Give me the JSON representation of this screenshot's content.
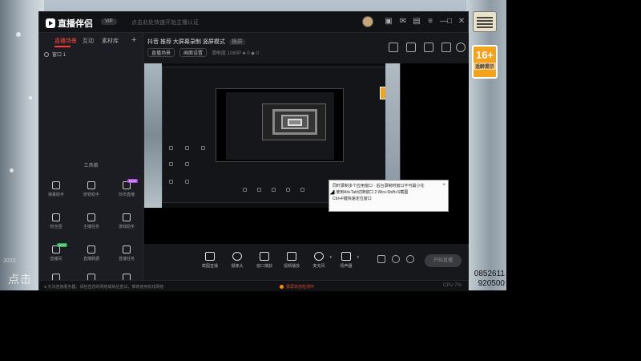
{
  "app": {
    "name": "直播伴侣",
    "version_tag": "VIP",
    "notice": "点击此处快速开始主播认证",
    "window_controls": [
      "avatar",
      "gift-icon",
      "message-icon",
      "shirt-icon",
      "settings-icon",
      "minimize-icon",
      "maximize-icon",
      "close-icon"
    ]
  },
  "desktop": {
    "left_text": "点击",
    "numbers": [
      "0852611",
      "920500"
    ],
    "tiny_text": "2022",
    "news_icon": "news-icon",
    "age_badge": {
      "big": "16+",
      "small": "适龄提示"
    }
  },
  "left_panel": {
    "tabs": [
      "直播场景",
      "互动",
      "素材库"
    ],
    "add_label": "+",
    "scene_item": "窗口 1",
    "toolbox_title": "工具箱",
    "tools": [
      {
        "label": "弹幕助手",
        "badge": ""
      },
      {
        "label": "房管助手",
        "badge": ""
      },
      {
        "label": "抖币直播",
        "badge": "NEW"
      },
      {
        "label": "粉丝团",
        "badge": ""
      },
      {
        "label": "主播任务",
        "badge": ""
      },
      {
        "label": "游戏助手",
        "badge": ""
      },
      {
        "label": "直播间",
        "badge": "NEW"
      },
      {
        "label": "直播数据",
        "badge": ""
      },
      {
        "label": "直播任务",
        "badge": ""
      },
      {
        "label": "设置",
        "badge": ""
      },
      {
        "label": "更多",
        "badge": ""
      },
      {
        "label": "分享",
        "badge": ""
      }
    ]
  },
  "scene_header": {
    "title": "抖音 推荐 大屏幕录制 竖屏模式",
    "tag": "横屏",
    "pill1": "直播场景",
    "pill2": "画面设置",
    "meta": "清晰度 1080P ♣ 0 ◆ 0"
  },
  "tooltip": {
    "row1": "同时录制多个应用窗口 · 后台录制时窗口不可最小化",
    "row2": "1.使用Alt+Tab切换窗口 2.Win+Shift+S截图",
    "row3": "Ctrl+F键快速定位窗口",
    "close": "×"
  },
  "controls": [
    {
      "label": "截图直播"
    },
    {
      "label": "摄像头"
    },
    {
      "label": "窗口捕获"
    },
    {
      "label": "视频播放"
    },
    {
      "label": "麦克风"
    },
    {
      "label": "扬声器"
    }
  ],
  "start_live": "开始直播",
  "statusbar": {
    "left": "● 无法连接服务器，请检查您的网络或稍后重试，推荐使用有线网络",
    "warn": "录屏状态检测中",
    "right": "CPU 7%"
  },
  "colors": {
    "accent": "#ff3b30",
    "panel": "#1c1d22",
    "bg": "#17181c"
  }
}
